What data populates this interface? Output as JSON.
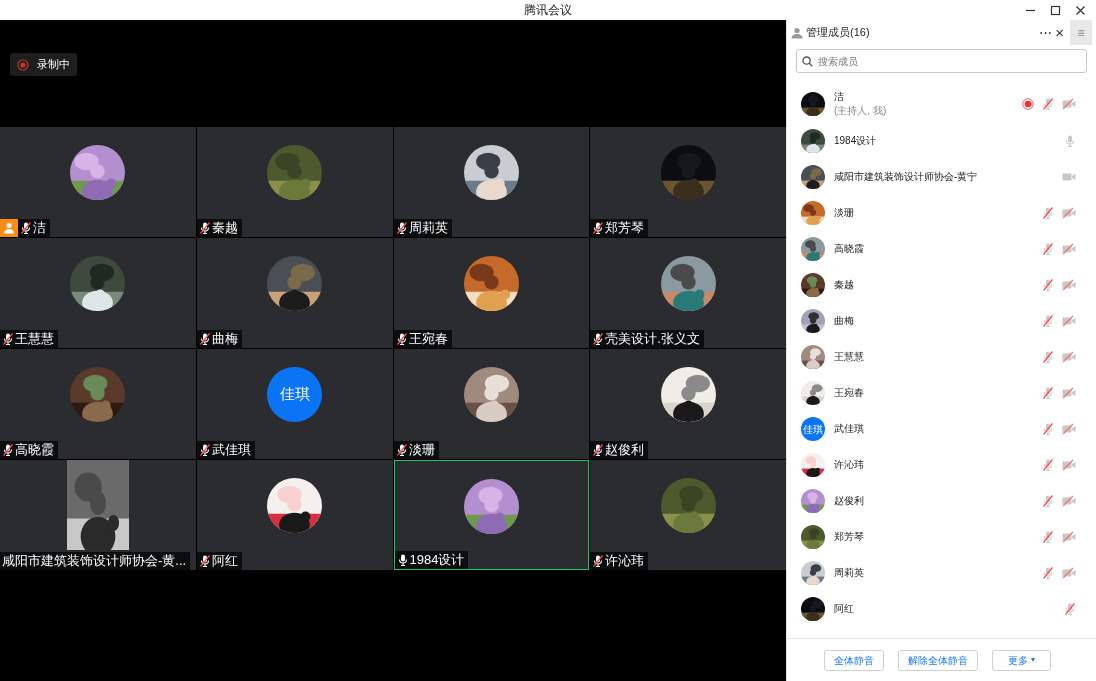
{
  "window": {
    "title": "腾讯会议"
  },
  "recording_badge": {
    "label": "录制中"
  },
  "tiles": [
    {
      "name": "洁",
      "kind": "picture",
      "host": true,
      "mic_muted": true,
      "speaking": false
    },
    {
      "name": "秦越",
      "kind": "picture",
      "host": false,
      "mic_muted": true,
      "speaking": false
    },
    {
      "name": "周莉英",
      "kind": "picture",
      "host": false,
      "mic_muted": true,
      "speaking": false
    },
    {
      "name": "郑芳琴",
      "kind": "picture",
      "host": false,
      "mic_muted": true,
      "speaking": false
    },
    {
      "name": "王慧慧",
      "kind": "picture",
      "host": false,
      "mic_muted": true,
      "speaking": false
    },
    {
      "name": "曲梅",
      "kind": "picture",
      "host": false,
      "mic_muted": true,
      "speaking": false
    },
    {
      "name": "王宛春",
      "kind": "picture",
      "host": false,
      "mic_muted": true,
      "speaking": false
    },
    {
      "name": "壳美设计.张义文",
      "kind": "picture",
      "host": false,
      "mic_muted": true,
      "speaking": false
    },
    {
      "name": "高晓霞",
      "kind": "picture",
      "host": false,
      "mic_muted": true,
      "speaking": false
    },
    {
      "name": "武佳琪",
      "kind": "initials",
      "initials": "佳琪",
      "host": false,
      "mic_muted": true,
      "speaking": false
    },
    {
      "name": "淡珊",
      "kind": "picture",
      "host": false,
      "mic_muted": true,
      "speaking": false
    },
    {
      "name": "赵俊利",
      "kind": "picture",
      "host": false,
      "mic_muted": true,
      "speaking": false
    },
    {
      "name": "咸阳市建筑装饰设计师协会-黄...",
      "kind": "video",
      "host": false,
      "speaking": false
    },
    {
      "name": "阿红",
      "kind": "picture",
      "host": false,
      "mic_muted": true,
      "speaking": false
    },
    {
      "name": "1984设计",
      "kind": "picture",
      "host": false,
      "mic_muted": false,
      "speaking": true
    },
    {
      "name": "许沁玮",
      "kind": "picture",
      "host": false,
      "mic_muted": true,
      "speaking": false
    }
  ],
  "members_panel": {
    "title": "管理成员(16)",
    "more": "⋯",
    "close": "×",
    "menu": "≡",
    "search": {
      "placeholder": "搜索成员"
    },
    "members": [
      {
        "name": "洁",
        "subtitle": "(主持人, 我)",
        "kind": "picture",
        "recording": true,
        "mic_muted": true,
        "camera_off": true
      },
      {
        "name": "1984设计",
        "kind": "picture",
        "recording": false,
        "mic_muted": false
      },
      {
        "name": "咸阳市建筑装饰设计师协会-黄宁",
        "kind": "picture",
        "recording": false,
        "camera_off": false
      },
      {
        "name": "淡珊",
        "kind": "picture",
        "recording": false,
        "mic_muted": true,
        "camera_off": true
      },
      {
        "name": "高晓霞",
        "kind": "picture",
        "recording": false,
        "mic_muted": true,
        "camera_off": true
      },
      {
        "name": "秦越",
        "kind": "picture",
        "recording": false,
        "mic_muted": true,
        "camera_off": true
      },
      {
        "name": "曲梅",
        "kind": "picture",
        "recording": false,
        "mic_muted": true,
        "camera_off": true
      },
      {
        "name": "王慧慧",
        "kind": "picture",
        "recording": false,
        "mic_muted": true,
        "camera_off": true
      },
      {
        "name": "王宛春",
        "kind": "picture",
        "recording": false,
        "mic_muted": true,
        "camera_off": true
      },
      {
        "name": "武佳琪",
        "kind": "initials",
        "initials": "佳琪",
        "recording": false,
        "mic_muted": true,
        "camera_off": true
      },
      {
        "name": "许沁玮",
        "kind": "picture",
        "recording": false,
        "mic_muted": true,
        "camera_off": true
      },
      {
        "name": "赵俊利",
        "kind": "picture",
        "recording": false,
        "mic_muted": true,
        "camera_off": true
      },
      {
        "name": "郑芳琴",
        "kind": "picture",
        "recording": false,
        "mic_muted": true,
        "camera_off": true
      },
      {
        "name": "周莉英",
        "kind": "picture",
        "recording": false,
        "mic_muted": true,
        "camera_off": true
      },
      {
        "name": "阿红",
        "kind": "picture",
        "recording": false,
        "mic_muted": true
      }
    ],
    "buttons": [
      "全体静音",
      "解除全体静音",
      "更多"
    ],
    "dropdown_caret": "▾"
  }
}
